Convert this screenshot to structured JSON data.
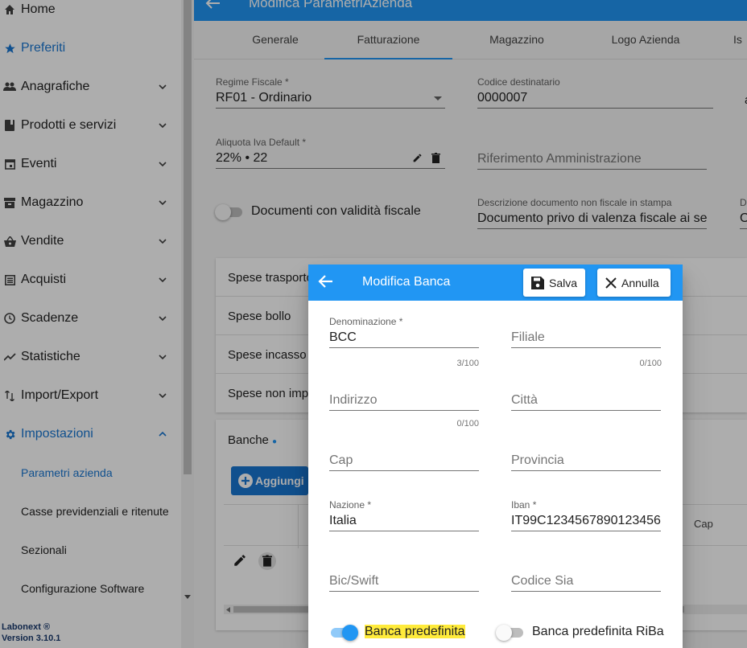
{
  "sidebar": {
    "items": [
      {
        "label": "Home",
        "icon": "home-icon"
      },
      {
        "label": "Preferiti",
        "icon": "star-icon"
      },
      {
        "label": "Anagrafiche",
        "icon": "people-icon"
      },
      {
        "label": "Prodotti e servizi",
        "icon": "book-icon"
      },
      {
        "label": "Eventi",
        "icon": "calendar-icon"
      },
      {
        "label": "Magazzino",
        "icon": "warehouse-icon"
      },
      {
        "label": "Vendite",
        "icon": "basket-icon"
      },
      {
        "label": "Acquisti",
        "icon": "list-icon"
      },
      {
        "label": "Scadenze",
        "icon": "clock-icon"
      },
      {
        "label": "Statistiche",
        "icon": "trend-icon"
      },
      {
        "label": "Import/Export",
        "icon": "swap-icon"
      },
      {
        "label": "Impostazioni",
        "icon": "gear-icon"
      }
    ],
    "subitems": [
      "Parametri azienda",
      "Casse previdenziali e ritenute",
      "Sezionali",
      "Configurazione Software"
    ],
    "version_line1": "Labonext ®",
    "version_line2": "Version 3.10.1"
  },
  "page": {
    "title": "Modifica ParametriAzienda",
    "tabs": [
      "Generale",
      "Fatturazione",
      "Magazzino",
      "Logo Azienda",
      "Is"
    ],
    "active_tab": "Fatturazione",
    "regime_label": "Regime Fiscale *",
    "regime_value": "RF01 - Ordinario",
    "codice_dest_label": "Codice destinatario",
    "codice_dest_value": "0000007",
    "aliquota_label": "Aliquota Iva Default *",
    "aliquota_value": "22% • 22",
    "rif_amm_placeholder": "Riferimento Amministrazione",
    "doc_validita_label": "Documenti con validità fiscale",
    "desc_doc_label": "Descrizione documento non fiscale in stampa",
    "desc_doc_value": "Documento privo di valenza fiscale ai sensi",
    "right_edge_label": "D",
    "right_edge_value": "O",
    "right_edge_a": "a",
    "spese": [
      "Spese trasporto",
      "Spese bollo",
      "Spese incasso",
      "Spese non imp"
    ],
    "banche_label": "Banche",
    "aggiungi_label": "Aggiungi",
    "cap_col": "Cap"
  },
  "dialog": {
    "title": "Modifica Banca",
    "save_label": "Salva",
    "cancel_label": "Annulla",
    "denominazione_label": "Denominazione *",
    "denominazione_value": "BCC",
    "denominazione_counter": "3/100",
    "filiale_placeholder": "Filiale",
    "filiale_counter": "0/100",
    "indirizzo_placeholder": "Indirizzo",
    "indirizzo_counter": "0/100",
    "citta_placeholder": "Città",
    "cap_placeholder": "Cap",
    "provincia_placeholder": "Provincia",
    "nazione_label": "Nazione *",
    "nazione_value": "Italia",
    "iban_label": "Iban *",
    "iban_value": "IT99C1234567890123456",
    "bic_placeholder": "Bic/Swift",
    "sia_placeholder": "Codice Sia",
    "banca_predefinita_label": "Banca predefinita",
    "banca_predefinita_on": true,
    "banca_riba_label": "Banca predefinita RiBa",
    "banca_riba_on": false
  },
  "colors": {
    "primary": "#2196f3",
    "active_text": "#1976d2",
    "highlight": "#ffeb3b"
  }
}
